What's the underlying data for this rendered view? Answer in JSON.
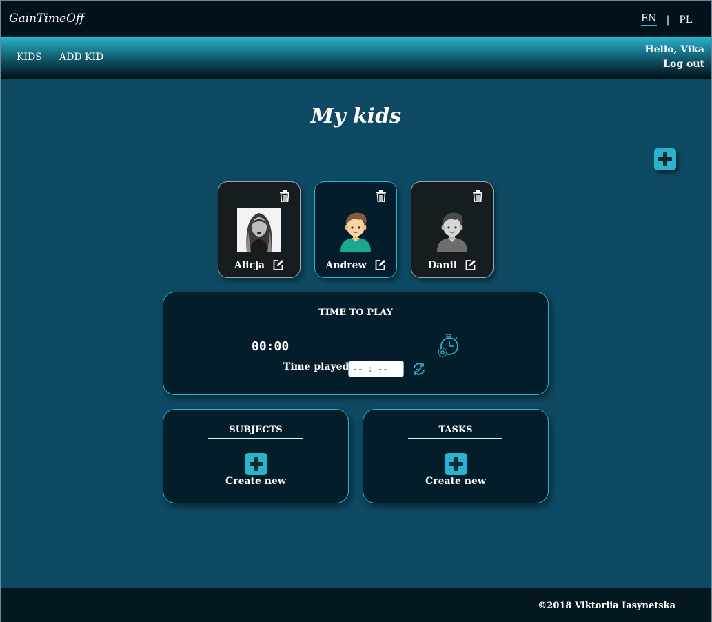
{
  "header": {
    "brand": "GainTimeOff",
    "lang_en": "EN",
    "lang_sep": "|",
    "lang_pl": "PL"
  },
  "nav": {
    "kids": "KIDS",
    "add_kid": "ADD KID",
    "greeting": "Hello, Vika",
    "logout": "Log out"
  },
  "page": {
    "title": "My kids"
  },
  "kids": [
    {
      "name": "Alicja",
      "avatar": "photo"
    },
    {
      "name": "Andrew",
      "avatar": "boy-color"
    },
    {
      "name": "Danil",
      "avatar": "boy-gray"
    }
  ],
  "time_panel": {
    "title": "TIME TO PLAY",
    "timer": "00:00",
    "played_label": "Time played:",
    "played_placeholder": "-- : --"
  },
  "subjects_panel": {
    "title": "SUBJECTS",
    "create": "Create new"
  },
  "tasks_panel": {
    "title": "TASKS",
    "create": "Create new"
  },
  "footer": {
    "copyright": "©2018 Viktoriia Iasynetska"
  },
  "colors": {
    "accent": "#2bb3cc",
    "background": "#0e4a63",
    "card_dark": "#041d2a"
  }
}
